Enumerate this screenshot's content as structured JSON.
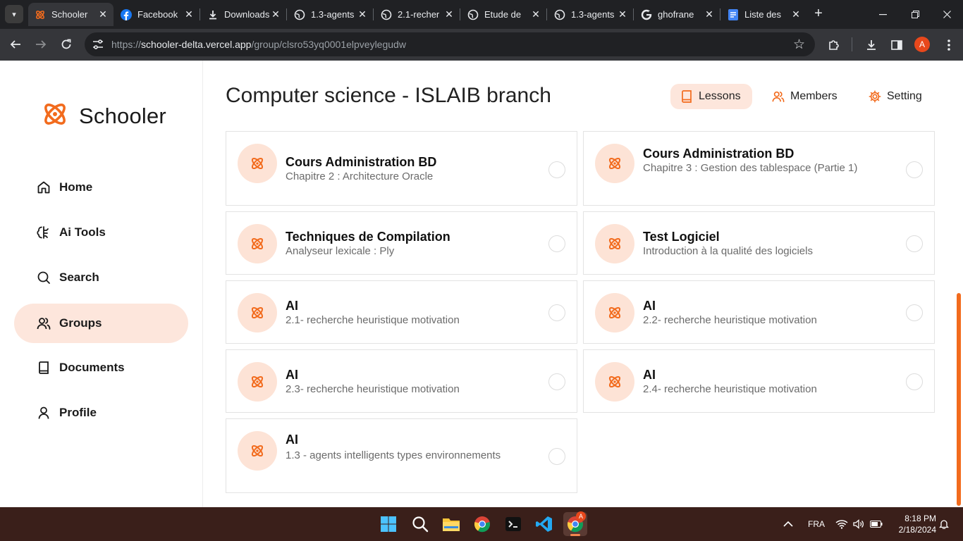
{
  "browser": {
    "tabs": [
      {
        "title": "Schooler",
        "favicon": "schooler-logo-icon",
        "active": true
      },
      {
        "title": "Facebook",
        "favicon": "facebook-icon"
      },
      {
        "title": "Downloads",
        "favicon": "download-icon"
      },
      {
        "title": "1.3-agents",
        "favicon": "globe-icon"
      },
      {
        "title": "2.1-recher",
        "favicon": "globe-icon"
      },
      {
        "title": "Etude de",
        "favicon": "globe-icon"
      },
      {
        "title": "1.3-agents",
        "favicon": "globe-icon"
      },
      {
        "title": "ghofrane",
        "favicon": "google-icon"
      },
      {
        "title": "Liste des",
        "favicon": "docs-icon"
      }
    ],
    "url_scheme": "https://",
    "url_host": "schooler-delta.vercel.app",
    "url_path": "/group/clsro53yq0001elpveylegudw",
    "profile_initial": "A"
  },
  "app": {
    "brand": "Schooler",
    "accent_color": "#f26b1d",
    "nav": [
      {
        "label": "Home",
        "icon": "home-icon"
      },
      {
        "label": "Ai Tools",
        "icon": "brain-icon"
      },
      {
        "label": "Search",
        "icon": "search-icon"
      },
      {
        "label": "Groups",
        "icon": "users-icon",
        "active": true
      },
      {
        "label": "Documents",
        "icon": "book-icon"
      },
      {
        "label": "Profile",
        "icon": "user-icon"
      }
    ]
  },
  "main": {
    "title": "Computer science - ISLAIB branch",
    "tabs": [
      {
        "label": "Lessons",
        "icon": "book-icon",
        "active": true
      },
      {
        "label": "Members",
        "icon": "users-icon"
      },
      {
        "label": "Setting",
        "icon": "gear-icon"
      }
    ],
    "lessons": [
      {
        "title": "Cours Administration BD",
        "subtitle": "Chapitre 2 : Architecture Oracle"
      },
      {
        "title": "Cours Administration BD",
        "subtitle": "Chapitre 3 : Gestion des tablespace (Partie 1)"
      },
      {
        "title": "Techniques de Compilation",
        "subtitle": "Analyseur lexicale : Ply"
      },
      {
        "title": "Test Logiciel",
        "subtitle": "Introduction à la qualité des logiciels"
      },
      {
        "title": "AI",
        "subtitle": "2.1- recherche heuristique motivation"
      },
      {
        "title": "AI",
        "subtitle": "2.2- recherche heuristique motivation"
      },
      {
        "title": "AI",
        "subtitle": "2.3- recherche heuristique motivation"
      },
      {
        "title": "AI",
        "subtitle": "2.4- recherche heuristique motivation"
      },
      {
        "title": "AI",
        "subtitle": "1.3 - agents intelligents types environnements"
      }
    ]
  },
  "taskbar": {
    "language": "FRA",
    "time": "8:18 PM",
    "date": "2/18/2024",
    "chrome_badge": "A"
  }
}
